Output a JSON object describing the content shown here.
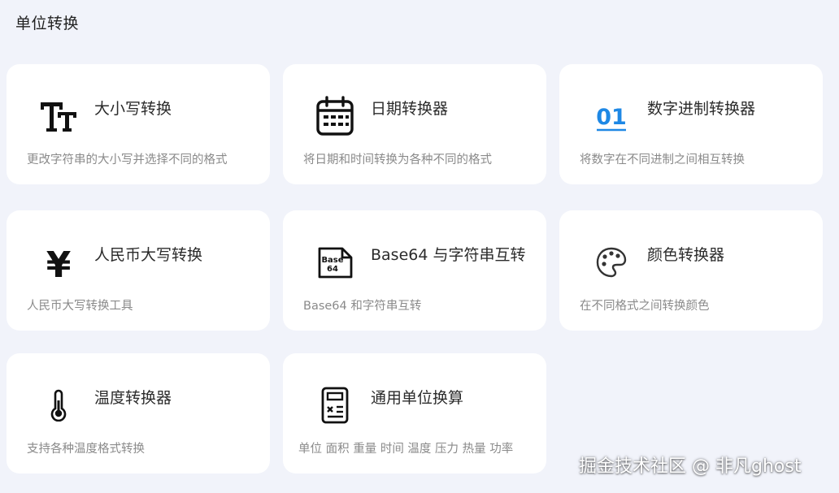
{
  "section": {
    "title": "单位转换"
  },
  "colors": {
    "page_bg": "#f1f3fa",
    "card_bg": "#ffffff",
    "accent_blue": "#1e88e5"
  },
  "tools": [
    {
      "title": "大小写转换",
      "desc": "更改字符串的大小写并选择不同的格式",
      "icon": "text-case-icon"
    },
    {
      "title": "日期转换器",
      "desc": "将日期和时间转换为各种不同的格式",
      "icon": "calendar-icon"
    },
    {
      "title": "数字进制转换器",
      "desc": "将数字在不同进制之间相互转换",
      "icon": "binary-icon",
      "icon_text": "01"
    },
    {
      "title": "人民币大写转换",
      "desc": "人民币大写转换工具",
      "icon": "yuan-icon",
      "icon_text": "¥"
    },
    {
      "title": "Base64 与字符串互转",
      "desc": "Base64 和字符串互转",
      "icon": "base64-file-icon",
      "icon_text": [
        "Base",
        "64"
      ]
    },
    {
      "title": "颜色转换器",
      "desc": "在不同格式之间转换颜色",
      "icon": "palette-icon"
    },
    {
      "title": "温度转换器",
      "desc": "支持各种温度格式转换",
      "icon": "thermometer-icon"
    },
    {
      "title": "通用单位换算",
      "desc": "单位 面积 重量 时间 温度 压力 热量 功率",
      "icon": "calculator-icon"
    }
  ],
  "watermark": {
    "text": "掘金技术社区 @ 非凡ghost"
  }
}
